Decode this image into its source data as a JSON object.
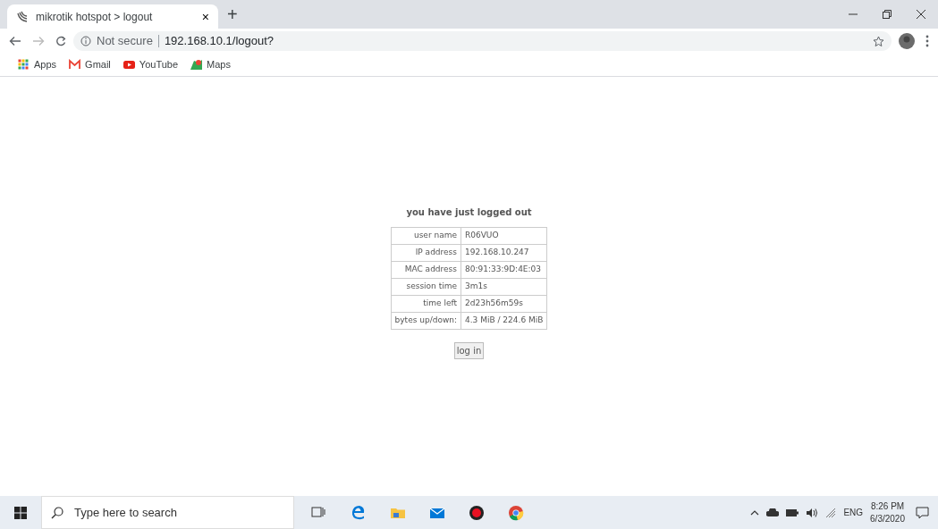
{
  "browser": {
    "tab_title": "mikrotik hotspot > logout",
    "tab_close": "×",
    "new_tab": "+",
    "security": "Not secure",
    "url": "192.168.10.1/logout?",
    "bookmarks": [
      {
        "label": "Apps",
        "kind": "apps"
      },
      {
        "label": "Gmail",
        "kind": "gmail"
      },
      {
        "label": "YouTube",
        "kind": "youtube"
      },
      {
        "label": "Maps",
        "kind": "maps"
      }
    ]
  },
  "page": {
    "heading": "you have just logged out",
    "rows": [
      {
        "label": "user name",
        "value": "R06VUO"
      },
      {
        "label": "IP address",
        "value": "192.168.10.247"
      },
      {
        "label": "MAC address",
        "value": "80:91:33:9D:4E:03"
      },
      {
        "label": "session time",
        "value": "3m1s"
      },
      {
        "label": "time left",
        "value": "2d23h56m59s"
      },
      {
        "label": "bytes up/down:",
        "value": "4.3 MiB / 224.6 MiB"
      }
    ],
    "login_button": "log in"
  },
  "taskbar": {
    "search_placeholder": "Type here to search",
    "language": "ENG",
    "time": "8:26 PM",
    "date": "6/3/2020",
    "apps": [
      {
        "kind": "task-view"
      },
      {
        "kind": "edge"
      },
      {
        "kind": "explorer"
      },
      {
        "kind": "mail"
      },
      {
        "kind": "record"
      },
      {
        "kind": "chrome"
      }
    ]
  }
}
